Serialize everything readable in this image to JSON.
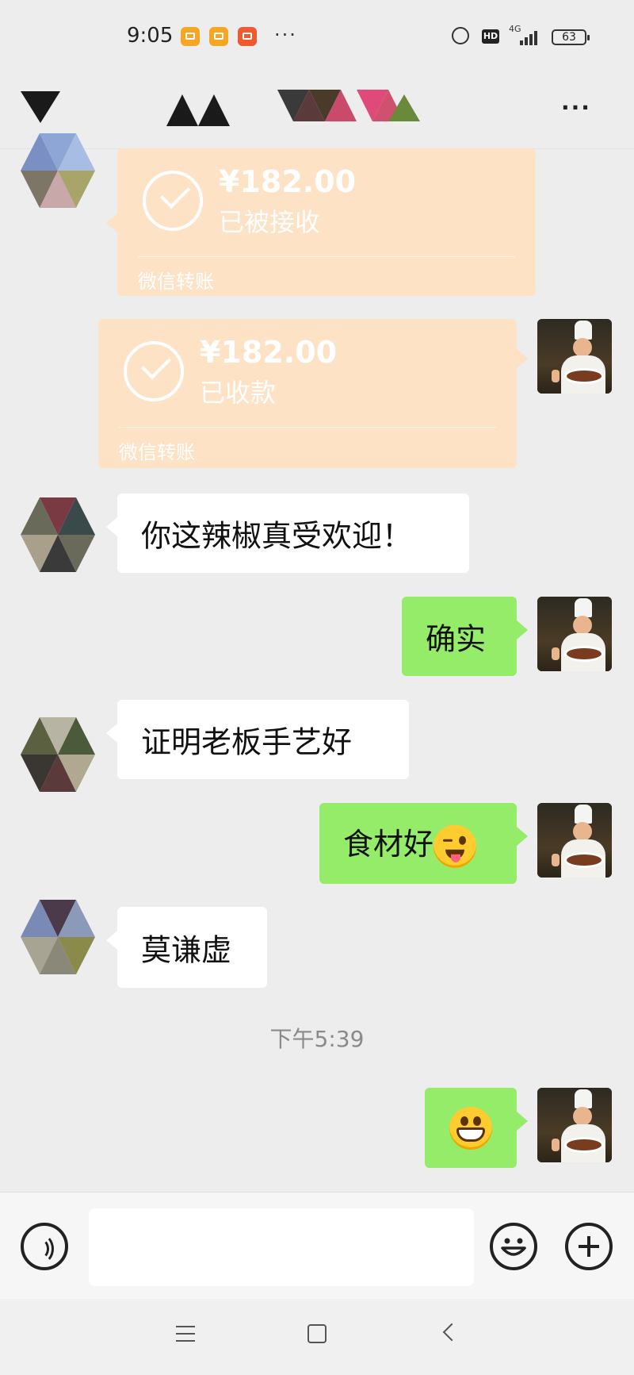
{
  "status_bar": {
    "time": "9:05",
    "battery": "63",
    "network": "4G",
    "hd": "HD",
    "dots": "···"
  },
  "header": {
    "more_label": "···"
  },
  "messages": [
    {
      "type": "transfer",
      "side": "left",
      "amount": "¥182.00",
      "status": "已被接收",
      "label": "微信转账"
    },
    {
      "type": "transfer",
      "side": "right",
      "amount": "¥182.00",
      "status": "已收款",
      "label": "微信转账"
    },
    {
      "type": "text",
      "side": "left",
      "text": "你这辣椒真受欢迎！"
    },
    {
      "type": "text",
      "side": "right",
      "text": "确实"
    },
    {
      "type": "text",
      "side": "left",
      "text": "证明老板手艺好"
    },
    {
      "type": "text",
      "side": "right",
      "text": "食材好",
      "emoji": "wink-tongue-emoji"
    },
    {
      "type": "text",
      "side": "left",
      "text": "莫谦虚"
    },
    {
      "type": "timestamp",
      "text": "下午5:39"
    },
    {
      "type": "emoji",
      "side": "right",
      "emoji": "grin-emoji"
    }
  ],
  "input_bar": {
    "value": "",
    "icons": [
      "voice-icon",
      "emoji-icon",
      "plus-icon"
    ]
  },
  "nav_bar": {
    "icons": [
      "menu-icon",
      "home-icon",
      "back-icon"
    ]
  },
  "colors": {
    "background": "#ededed",
    "sent_bubble": "#95ec69",
    "received_bubble": "#ffffff",
    "transfer_card": "#fde2c6"
  }
}
